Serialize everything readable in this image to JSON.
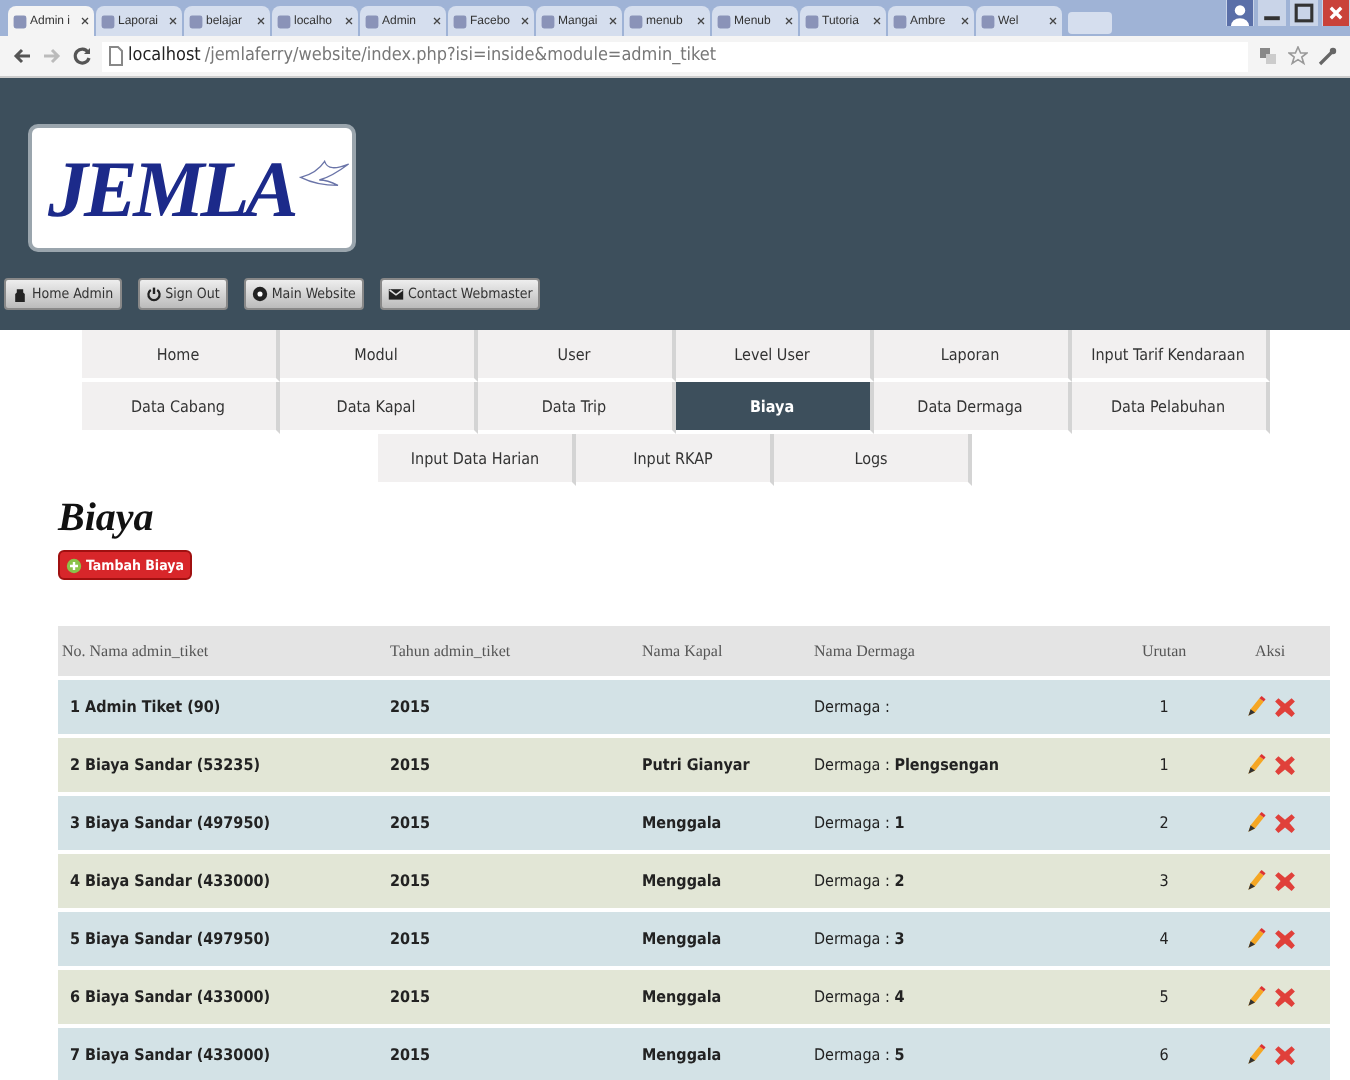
{
  "browser": {
    "tabs": [
      {
        "label": "Admin i",
        "selected": true
      },
      {
        "label": "Laporai",
        "selected": false
      },
      {
        "label": "belajar",
        "selected": false
      },
      {
        "label": "localho",
        "selected": false
      },
      {
        "label": "Admin",
        "selected": false
      },
      {
        "label": "Facebo",
        "selected": false
      },
      {
        "label": "Mangai",
        "selected": false
      },
      {
        "label": "menub",
        "selected": false
      },
      {
        "label": "Menub",
        "selected": false
      },
      {
        "label": "Tutoria",
        "selected": false
      },
      {
        "label": "Ambre",
        "selected": false
      },
      {
        "label": "Wel",
        "selected": false
      }
    ],
    "url_host": "localhost",
    "url_path": "/jemlaferry/website/index.php?isi=inside&module=admin_tiket"
  },
  "header": {
    "logo": "JEMLA",
    "buttons": [
      {
        "label": "Home Admin",
        "kind": "home"
      },
      {
        "label": "Sign Out",
        "kind": "power"
      },
      {
        "label": "Main Website",
        "kind": "globe"
      },
      {
        "label": "Contact Webmaster",
        "kind": "mail"
      }
    ]
  },
  "menu": {
    "rows": [
      [
        {
          "label": "Home",
          "selected": false
        },
        {
          "label": "Modul",
          "selected": false
        },
        {
          "label": "User",
          "selected": false
        },
        {
          "label": "Level User",
          "selected": false
        },
        {
          "label": "Laporan",
          "selected": false
        },
        {
          "label": "Input Tarif Kendaraan",
          "selected": false
        }
      ],
      [
        {
          "label": "Data Cabang",
          "selected": false
        },
        {
          "label": "Data Kapal",
          "selected": false
        },
        {
          "label": "Data Trip",
          "selected": false
        },
        {
          "label": "Biaya",
          "selected": true
        },
        {
          "label": "Data Dermaga",
          "selected": false
        },
        {
          "label": "Data Pelabuhan",
          "selected": false
        }
      ],
      [
        {
          "label": "Input Data Harian",
          "selected": false
        },
        {
          "label": "Input RKAP",
          "selected": false
        },
        {
          "label": "Logs",
          "selected": false
        }
      ]
    ]
  },
  "page": {
    "title": "Biaya",
    "add_button": "Tambah Biaya"
  },
  "table": {
    "columns": [
      "No.",
      "Nama admin_tiket",
      "Tahun admin_tiket",
      "Nama Kapal",
      "Nama Dermaga",
      "Urutan",
      "Aksi"
    ],
    "rows": [
      {
        "no": "1",
        "nama": "Admin Tiket (90)",
        "tahun": "2015",
        "kapal": "",
        "dermaga": "Dermaga :",
        "urutan": "1"
      },
      {
        "no": "2",
        "nama": "Biaya Sandar (53235)",
        "tahun": "2015",
        "kapal": "Putri Gianyar",
        "dermaga": "Dermaga : **Plengsengan**",
        "urutan": "1"
      },
      {
        "no": "3",
        "nama": "Biaya Sandar (497950)",
        "tahun": "2015",
        "kapal": "Menggala",
        "dermaga": "Dermaga : **1**",
        "urutan": "2"
      },
      {
        "no": "4",
        "nama": "Biaya Sandar (433000)",
        "tahun": "2015",
        "kapal": "Menggala",
        "dermaga": "Dermaga : **2**",
        "urutan": "3"
      },
      {
        "no": "5",
        "nama": "Biaya Sandar (497950)",
        "tahun": "2015",
        "kapal": "Menggala",
        "dermaga": "Dermaga : **3**",
        "urutan": "4"
      },
      {
        "no": "6",
        "nama": "Biaya Sandar (433000)",
        "tahun": "2015",
        "kapal": "Menggala",
        "dermaga": "Dermaga : **4**",
        "urutan": "5"
      },
      {
        "no": "7",
        "nama": "Biaya Sandar (433000)",
        "tahun": "2015",
        "kapal": "Menggala",
        "dermaga": "Dermaga : **5**",
        "urutan": "6"
      }
    ]
  }
}
